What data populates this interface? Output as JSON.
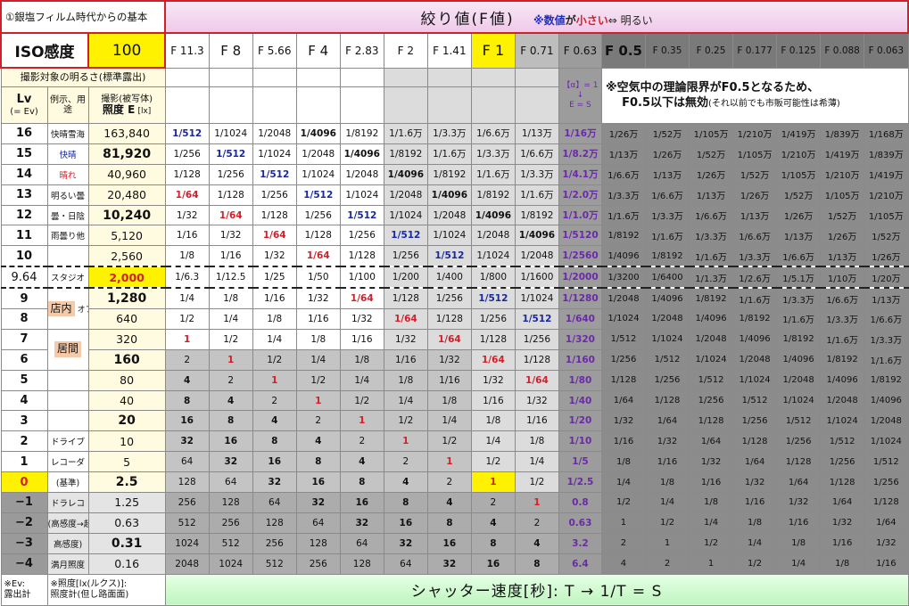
{
  "title_left": "①銀塩フィルム時代からの基本",
  "title_main": "絞り値(F値)",
  "title_note_pre": "※",
  "title_note_a": "数値",
  "title_note_b": "が",
  "title_note_c": "小さい",
  "title_note_d": "⇔ 明るい",
  "iso_label": "ISO感度",
  "iso_value": "100",
  "fnumbers": [
    "F 11.3",
    "F 8",
    "F 5.66",
    "F 4",
    "F 2.83",
    "F 2",
    "F 1.41",
    "F 1",
    "F 0.71",
    "F 0.63",
    "F 0.5",
    "F 0.35",
    "F 0.25",
    "F 0.177",
    "F 0.125",
    "F 0.088",
    "F 0.063"
  ],
  "subject_header": "撮影対象の明るさ(標準露出)",
  "lv_header": "Lv",
  "lv_header_sub": "(= Ev)",
  "example_header": "例示、用途",
  "illum_header_a": "撮影(被写体)",
  "illum_header_b": "照度 E",
  "illum_header_unit": "[lx]",
  "f063_note": "【α】= 1\n↓\nE = S",
  "warning_a": "※空気中の理論限界がF0.5となるため、",
  "warning_b": "F0.5以下は無効",
  "warning_c": "(それ以前でも市販可能性は希薄)",
  "pillar_a": "店内",
  "pillar_b": "居間",
  "rows": [
    {
      "lv": "16",
      "ex": "快晴雪海",
      "ill": "163,840",
      "c": [
        "1/512",
        "1/1024",
        "1/2048",
        "1/4096",
        "1/8192",
        "1/1.6万",
        "1/3.3万",
        "1/6.6万",
        "1/13万",
        "1/16万",
        "1/26万",
        "1/52万",
        "1/105万",
        "1/210万",
        "1/419万",
        "1/839万",
        "1/168万"
      ]
    },
    {
      "lv": "15",
      "ex": "快晴",
      "ill": "81,920",
      "c": [
        "1/256",
        "1/512",
        "1/1024",
        "1/2048",
        "1/4096",
        "1/8192",
        "1/1.6万",
        "1/3.3万",
        "1/6.6万",
        "1/8.2万",
        "1/13万",
        "1/26万",
        "1/52万",
        "1/105万",
        "1/210万",
        "1/419万",
        "1/839万"
      ]
    },
    {
      "lv": "14",
      "ex": "晴れ",
      "ill": "40,960",
      "c": [
        "1/128",
        "1/256",
        "1/512",
        "1/1024",
        "1/2048",
        "1/4096",
        "1/8192",
        "1/1.6万",
        "1/3.3万",
        "1/4.1万",
        "1/6.6万",
        "1/13万",
        "1/26万",
        "1/52万",
        "1/105万",
        "1/210万",
        "1/419万"
      ]
    },
    {
      "lv": "13",
      "ex": "明るい曇",
      "ill": "20,480",
      "c": [
        "1/64",
        "1/128",
        "1/256",
        "1/512",
        "1/1024",
        "1/2048",
        "1/4096",
        "1/8192",
        "1/1.6万",
        "1/2.0万",
        "1/3.3万",
        "1/6.6万",
        "1/13万",
        "1/26万",
        "1/52万",
        "1/105万",
        "1/210万"
      ]
    },
    {
      "lv": "12",
      "ex": "曇・日陰",
      "ill": "10,240",
      "c": [
        "1/32",
        "1/64",
        "1/128",
        "1/256",
        "1/512",
        "1/1024",
        "1/2048",
        "1/4096",
        "1/8192",
        "1/1.0万",
        "1/1.6万",
        "1/3.3万",
        "1/6.6万",
        "1/13万",
        "1/26万",
        "1/52万",
        "1/105万"
      ]
    },
    {
      "lv": "11",
      "ex": "雨曇り他",
      "ill": "5,120",
      "c": [
        "1/16",
        "1/32",
        "1/64",
        "1/128",
        "1/256",
        "1/512",
        "1/1024",
        "1/2048",
        "1/4096",
        "1/5120",
        "1/8192",
        "1/1.6万",
        "1/3.3万",
        "1/6.6万",
        "1/13万",
        "1/26万",
        "1/52万"
      ]
    },
    {
      "lv": "10",
      "ex": "",
      "ill": "2,560",
      "c": [
        "1/8",
        "1/16",
        "1/32",
        "1/64",
        "1/128",
        "1/256",
        "1/512",
        "1/1024",
        "1/2048",
        "1/2560",
        "1/4096",
        "1/8192",
        "1/1.6万",
        "1/3.3万",
        "1/6.6万",
        "1/13万",
        "1/26万"
      ]
    },
    {
      "lv": "9.64",
      "ex": "スタジオ",
      "ill": "2,000",
      "c": [
        "1/6.3",
        "1/12.5",
        "1/25",
        "1/50",
        "1/100",
        "1/200",
        "1/400",
        "1/800",
        "1/1600",
        "1/2000",
        "1/3200",
        "1/6400",
        "1/1.3万",
        "1/2.6万",
        "1/5.1万",
        "1/10万",
        "1/20万"
      ]
    },
    {
      "lv": "9",
      "ex": "",
      "ill": "1,280",
      "c": [
        "1/4",
        "1/8",
        "1/16",
        "1/32",
        "1/64",
        "1/128",
        "1/256",
        "1/512",
        "1/1024",
        "1/1280",
        "1/2048",
        "1/4096",
        "1/8192",
        "1/1.6万",
        "1/3.3万",
        "1/6.6万",
        "1/13万"
      ]
    },
    {
      "lv": "8",
      "ex": "オフィス",
      "ill": "640",
      "c": [
        "1/2",
        "1/4",
        "1/8",
        "1/16",
        "1/32",
        "1/64",
        "1/128",
        "1/256",
        "1/512",
        "1/640",
        "1/1024",
        "1/2048",
        "1/4096",
        "1/8192",
        "1/1.6万",
        "1/3.3万",
        "1/6.6万"
      ]
    },
    {
      "lv": "7",
      "ex": "",
      "ill": "320",
      "c": [
        "1",
        "1/2",
        "1/4",
        "1/8",
        "1/16",
        "1/32",
        "1/64",
        "1/128",
        "1/256",
        "1/320",
        "1/512",
        "1/1024",
        "1/2048",
        "1/4096",
        "1/8192",
        "1/1.6万",
        "1/3.3万"
      ]
    },
    {
      "lv": "6",
      "ex": "",
      "ill": "160",
      "c": [
        "2",
        "1",
        "1/2",
        "1/4",
        "1/8",
        "1/16",
        "1/32",
        "1/64",
        "1/128",
        "1/160",
        "1/256",
        "1/512",
        "1/1024",
        "1/2048",
        "1/4096",
        "1/8192",
        "1/1.6万"
      ]
    },
    {
      "lv": "5",
      "ex": "",
      "ill": "80",
      "c": [
        "4",
        "2",
        "1",
        "1/2",
        "1/4",
        "1/8",
        "1/16",
        "1/32",
        "1/64",
        "1/80",
        "1/128",
        "1/256",
        "1/512",
        "1/1024",
        "1/2048",
        "1/4096",
        "1/8192"
      ]
    },
    {
      "lv": "4",
      "ex": "",
      "ill": "40",
      "c": [
        "8",
        "4",
        "2",
        "1",
        "1/2",
        "1/4",
        "1/8",
        "1/16",
        "1/32",
        "1/40",
        "1/64",
        "1/128",
        "1/256",
        "1/512",
        "1/1024",
        "1/2048",
        "1/4096"
      ]
    },
    {
      "lv": "3",
      "ex": "",
      "ill": "20",
      "c": [
        "16",
        "8",
        "4",
        "2",
        "1",
        "1/2",
        "1/4",
        "1/8",
        "1/16",
        "1/20",
        "1/32",
        "1/64",
        "1/128",
        "1/256",
        "1/512",
        "1/1024",
        "1/2048"
      ]
    },
    {
      "lv": "2",
      "ex": "ドライブ",
      "ill": "10",
      "c": [
        "32",
        "16",
        "8",
        "4",
        "2",
        "1",
        "1/2",
        "1/4",
        "1/8",
        "1/10",
        "1/16",
        "1/32",
        "1/64",
        "1/128",
        "1/256",
        "1/512",
        "1/1024"
      ]
    },
    {
      "lv": "1",
      "ex": "レコーダ",
      "ill": "5",
      "c": [
        "64",
        "32",
        "16",
        "8",
        "4",
        "2",
        "1",
        "1/2",
        "1/4",
        "1/5",
        "1/8",
        "1/16",
        "1/32",
        "1/64",
        "1/128",
        "1/256",
        "1/512"
      ]
    },
    {
      "lv": "0",
      "ex": "(基準)",
      "ill": "2.5",
      "c": [
        "128",
        "64",
        "32",
        "16",
        "8",
        "4",
        "2",
        "1",
        "1/2",
        "1/2.5",
        "1/4",
        "1/8",
        "1/16",
        "1/32",
        "1/64",
        "1/128",
        "1/256"
      ]
    },
    {
      "lv": "−1",
      "ex": "ドラレコ",
      "ill": "1.25",
      "c": [
        "256",
        "128",
        "64",
        "32",
        "16",
        "8",
        "4",
        "2",
        "1",
        "0.8",
        "1/2",
        "1/4",
        "1/8",
        "1/16",
        "1/32",
        "1/64",
        "1/128"
      ]
    },
    {
      "lv": "−2",
      "ex": "(高感度→超",
      "ill": "0.63",
      "c": [
        "512",
        "256",
        "128",
        "64",
        "32",
        "16",
        "8",
        "4",
        "2",
        "0.63",
        "1",
        "1/2",
        "1/4",
        "1/8",
        "1/16",
        "1/32",
        "1/64"
      ]
    },
    {
      "lv": "−3",
      "ex": "高感度)",
      "ill": "0.31",
      "c": [
        "1024",
        "512",
        "256",
        "128",
        "64",
        "32",
        "16",
        "8",
        "4",
        "3.2",
        "2",
        "1",
        "1/2",
        "1/4",
        "1/8",
        "1/16",
        "1/32"
      ]
    },
    {
      "lv": "−4",
      "ex": "満月照度",
      "ill": "0.16",
      "c": [
        "2048",
        "1024",
        "512",
        "256",
        "128",
        "64",
        "32",
        "16",
        "8",
        "6.4",
        "4",
        "2",
        "1",
        "1/2",
        "1/4",
        "1/8",
        "1/16"
      ]
    }
  ],
  "foot_a": "※Ev:",
  "foot_b": "露出計",
  "foot_c": "※照度[lx(ルクス)]:",
  "foot_d": "照度計(但し路面面)",
  "foot_main": "シャッター速度[秒]: T → 1/T = S"
}
